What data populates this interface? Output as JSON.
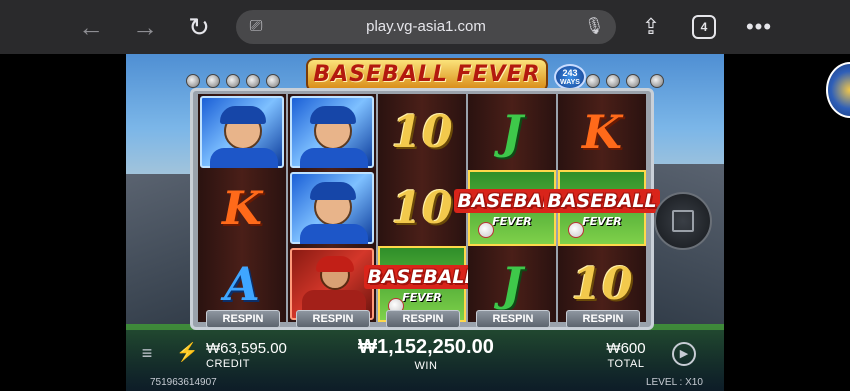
{
  "browser": {
    "url": "play.vg-asia1.com",
    "back_icon": "←",
    "forward_icon": "→",
    "reload_icon": "↻",
    "reader_icon": "⎚",
    "mic_icon": "🎙",
    "share_icon": "⇪",
    "tab_count": "4",
    "more_icon": "•••"
  },
  "game": {
    "logo": "BASEBALL FEVER",
    "ways_top": "243",
    "ways_bottom": "WAYS",
    "reels": [
      [
        "player",
        "K",
        "A"
      ],
      [
        "player",
        "player",
        "catcher"
      ],
      [
        "10",
        "10",
        "baseball"
      ],
      [
        "J",
        "baseball",
        "J"
      ],
      [
        "K",
        "baseball",
        "10"
      ]
    ],
    "symbols": {
      "ten": "10",
      "j": "J",
      "k": "K",
      "a": "A",
      "baseball_word": "BASEBALL",
      "baseball_sub": "FEVER"
    },
    "respin_label": "RESPIN",
    "credit_value": "₩63,595.00",
    "credit_label": "CREDIT",
    "win_value": "₩1,152,250.00",
    "win_label": "WIN",
    "total_value": "₩600",
    "total_label": "TOTAL",
    "session_id": "751963614907",
    "level_label": "LEVEL : X10",
    "menu_icon": "≡",
    "turbo_icon": "⚡",
    "autoplay_icon": "▶"
  },
  "colors": {
    "browser_bar": "#2a2a2c",
    "url_pill": "#48484a",
    "reel_bg": "#4a1f18",
    "gold": "#f2c94c"
  }
}
